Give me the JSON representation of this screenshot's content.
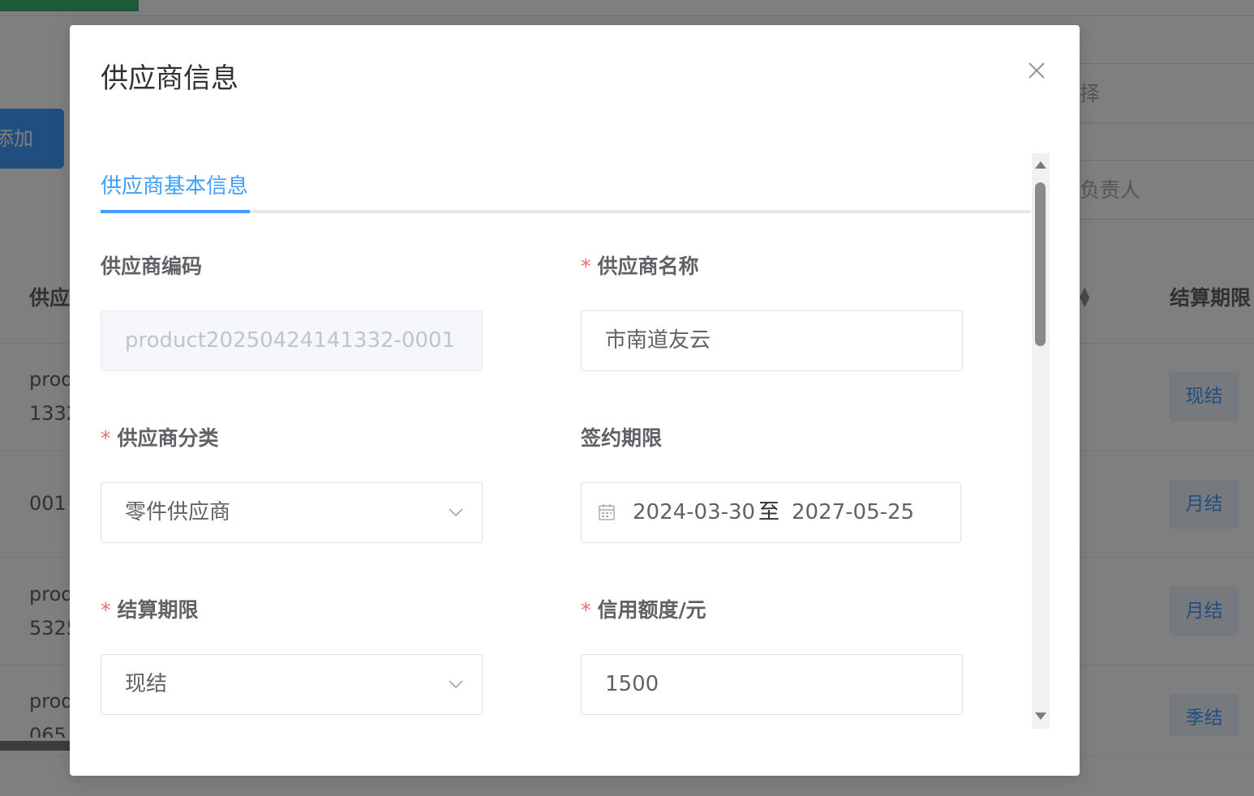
{
  "background": {
    "add_button": "添加",
    "filter_placeholder_1": "择",
    "filter_placeholder_2": "负责人",
    "table_header_left": "供应",
    "table_header_right": "结算期限",
    "rows": [
      {
        "line1": "prod",
        "line2": "1332",
        "tag": "现结"
      },
      {
        "line1": "001",
        "line2": "",
        "tag": "月结"
      },
      {
        "line1": "prod",
        "line2": "5325",
        "tag": "月结"
      },
      {
        "line1": "prod",
        "line2": "065",
        "tag": "季结"
      }
    ]
  },
  "dialog": {
    "title": "供应商信息",
    "tab": "供应商基本信息",
    "fields": {
      "code": {
        "label": "供应商编码",
        "value": "product20250424141332-0001"
      },
      "name": {
        "label": "供应商名称",
        "required_mark": "*",
        "value": "市南道友云"
      },
      "category": {
        "label": "供应商分类",
        "required_mark": "*",
        "value": "零件供应商"
      },
      "contract_period": {
        "label": "签约期限",
        "start": "2024-03-30",
        "separator": "至",
        "end": "2027-05-25"
      },
      "settlement": {
        "label": "结算期限",
        "required_mark": "*",
        "value": "现结"
      },
      "credit": {
        "label": "信用额度/元",
        "required_mark": "*",
        "value": "1500"
      }
    }
  },
  "icons": {
    "close": "close-icon",
    "dropdown": "chevron-down-icon",
    "calendar": "calendar-icon"
  },
  "colors": {
    "primary": "#409eff",
    "required": "#f56c6c",
    "tag_bg": "#ecf5ff"
  }
}
